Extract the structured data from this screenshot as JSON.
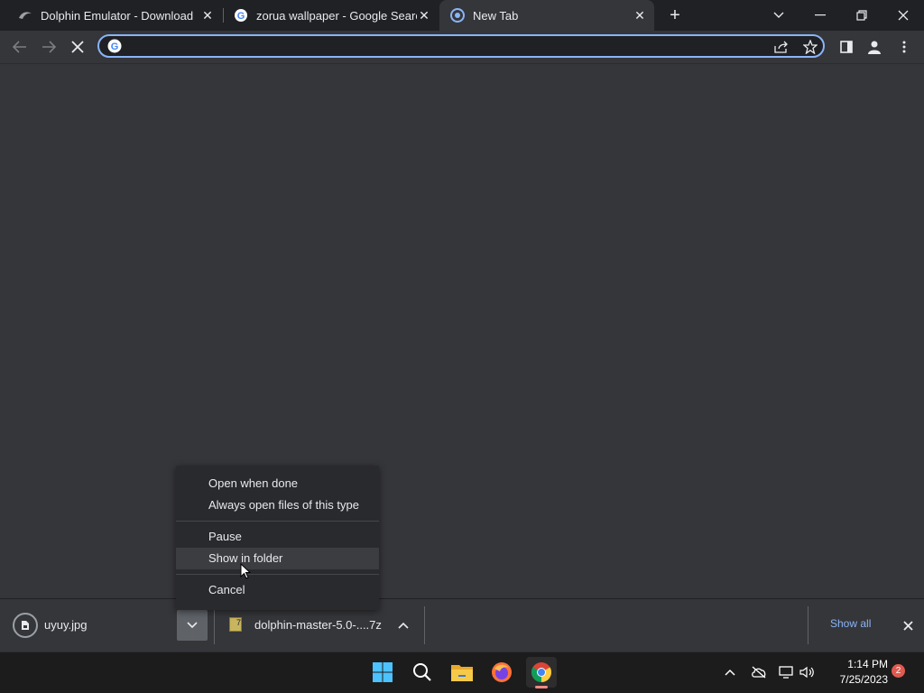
{
  "tabs": [
    {
      "title": "Dolphin Emulator - Download",
      "icon": "dolphin-icon"
    },
    {
      "title": "zorua wallpaper - Google Search",
      "icon": "google-icon"
    },
    {
      "title": "New Tab",
      "icon": "chrome-newtab-icon",
      "active": true
    }
  ],
  "omnibox": {
    "value": "",
    "placeholder": ""
  },
  "context_menu": {
    "items": [
      {
        "label": "Open when done"
      },
      {
        "label": "Always open files of this type"
      },
      {
        "label": "Pause"
      },
      {
        "label": "Show in folder",
        "highlighted": true
      },
      {
        "label": "Cancel"
      }
    ]
  },
  "downloads": [
    {
      "name": "uyuy.jpg",
      "icon": "file-icon"
    },
    {
      "name": "dolphin-master-5.0-....7z",
      "icon": "zip-icon"
    }
  ],
  "shelf": {
    "show_all_label": "Show all"
  },
  "taskbar": {
    "apps": [
      "windows-start-icon",
      "search-icon",
      "file-explorer-icon",
      "firefox-icon",
      "chrome-icon"
    ],
    "time": "1:14 PM",
    "date": "7/25/2023",
    "notification_count": "2"
  },
  "colors": {
    "accent": "#8ab4f8",
    "background": "#35363a",
    "tabstrip": "#202124",
    "taskbar": "#1c1c1c"
  }
}
